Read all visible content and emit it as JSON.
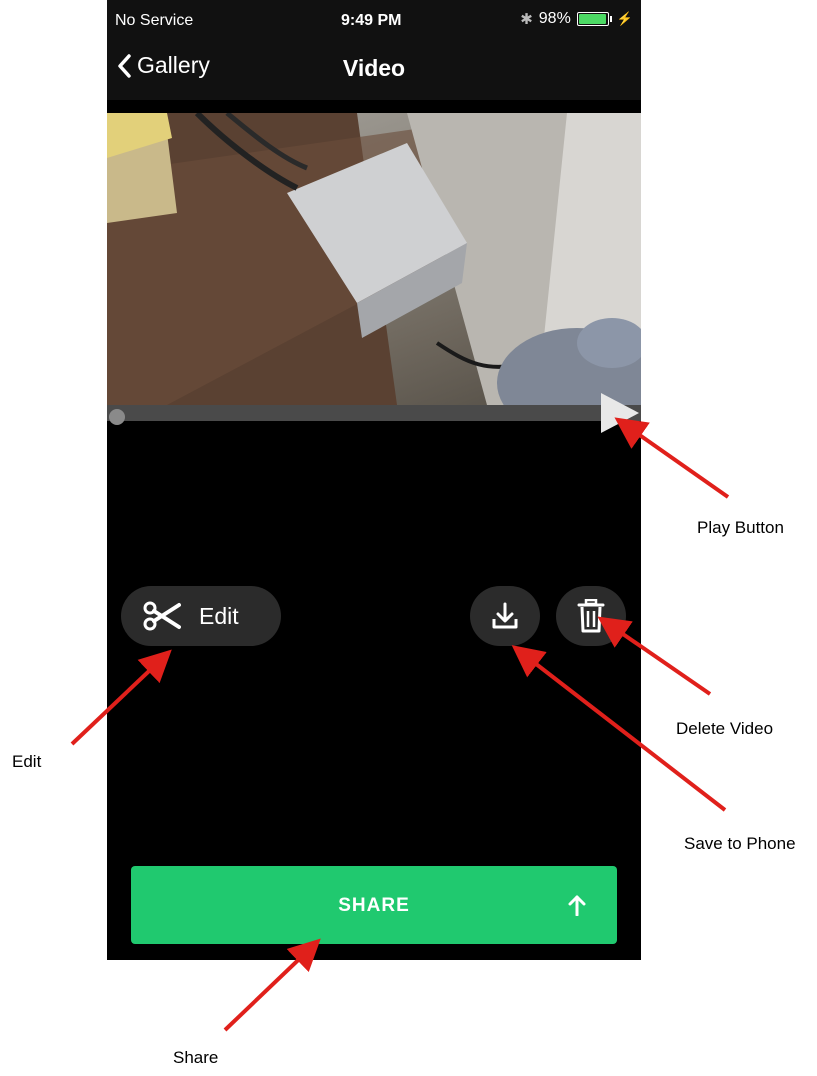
{
  "status_bar": {
    "carrier": "No Service",
    "time": "9:49 PM",
    "battery": "98%",
    "battery_level": 0.98
  },
  "nav": {
    "back_label": "Gallery",
    "title": "Video"
  },
  "actions": {
    "edit_label": "Edit",
    "share_label": "SHARE"
  },
  "annotations": {
    "play": "Play Button",
    "delete": "Delete Video",
    "edit": "Edit",
    "save": "Save to Phone",
    "share": "Share"
  },
  "colors": {
    "share_green": "#20c96f",
    "arrow_red": "#e0201b",
    "button_dark": "#2b2b2b"
  },
  "icons": {
    "back": "chevron-left-icon",
    "bluetooth": "bluetooth-icon",
    "battery": "battery-icon",
    "charging": "bolt-icon",
    "edit": "scissors-icon",
    "save": "download-icon",
    "delete": "trash-icon",
    "share": "arrow-up-icon",
    "play": "play-icon"
  }
}
